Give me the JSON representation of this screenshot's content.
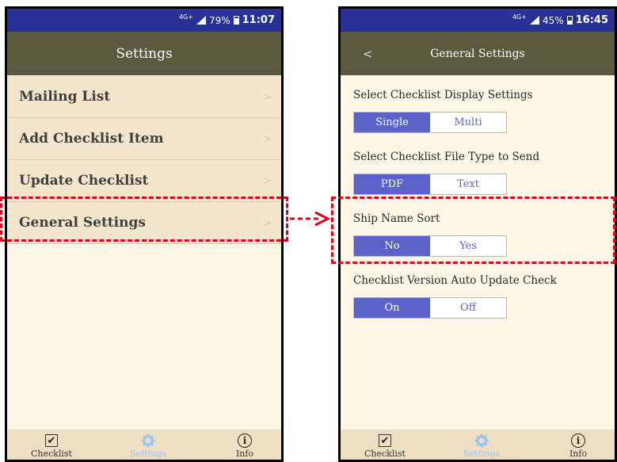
{
  "left": {
    "status": {
      "network": "4G+",
      "battery": "79%",
      "time": "11:07",
      "battery_level": 0.79
    },
    "title": "Settings",
    "menu": [
      {
        "label": "Mailing List",
        "chevron": ">"
      },
      {
        "label": "Add Checklist Item",
        "chevron": ">"
      },
      {
        "label": "Update Checklist",
        "chevron": ">"
      },
      {
        "label": "General Settings",
        "chevron": ">"
      }
    ]
  },
  "right": {
    "status": {
      "network": "4G+",
      "battery": "45%",
      "time": "16:45",
      "battery_level": 0.45
    },
    "back": "<",
    "title": "General Settings",
    "sections": [
      {
        "label": "Select Checklist Display Settings",
        "options": [
          "Single",
          "Multi"
        ],
        "selected": "Single"
      },
      {
        "label": "Select Checklist File Type to Send",
        "options": [
          "PDF",
          "Text"
        ],
        "selected": "PDF"
      },
      {
        "label": "Ship Name Sort",
        "options": [
          "No",
          "Yes"
        ],
        "selected": "No"
      },
      {
        "label": "Checklist Version Auto Update Check",
        "options": [
          "On",
          "Off"
        ],
        "selected": "On"
      }
    ]
  },
  "tabs": [
    {
      "label": "Checklist",
      "icon": "checkbox-icon"
    },
    {
      "label": "Settings",
      "icon": "gear-icon",
      "active": true
    },
    {
      "label": "Info",
      "icon": "info-icon"
    }
  ],
  "colors": {
    "statusbar": "#2a3196",
    "titlebar": "#5b5a3e",
    "menu_bg": "#f3e6cc",
    "segment_selected": "#5b63c9",
    "highlight": "#e2001a",
    "tab_active": "#9cc4f0"
  }
}
